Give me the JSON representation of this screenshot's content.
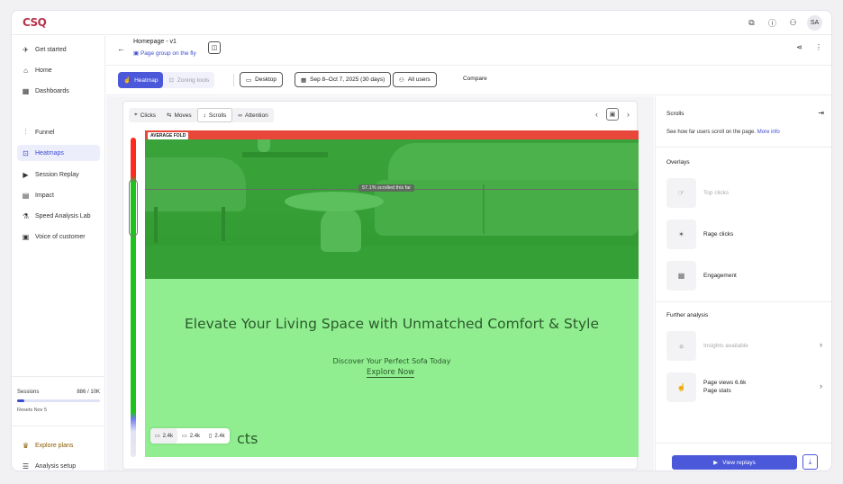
{
  "app": {
    "logo": "CSQ",
    "avatar": "SA"
  },
  "sidebar": {
    "items": [
      {
        "label": "Get started",
        "icon": "rocket-icon"
      },
      {
        "label": "Home",
        "icon": "home-icon"
      },
      {
        "label": "Dashboards",
        "icon": "grid-icon"
      },
      {
        "label": "Funnel",
        "icon": "funnel-icon"
      },
      {
        "label": "Heatmaps",
        "icon": "heatmap-icon"
      },
      {
        "label": "Session Replay",
        "icon": "play-icon"
      },
      {
        "label": "Impact",
        "icon": "impact-icon"
      },
      {
        "label": "Speed Analysis Lab",
        "icon": "speed-icon"
      },
      {
        "label": "Voice of customer",
        "icon": "voc-icon"
      }
    ],
    "sessions": {
      "label": "Sessions",
      "count": "886 / 10K",
      "progress": 0.0886,
      "reset": "Resets Nov 5"
    },
    "explore_plans": "Explore plans",
    "analysis_setup": "Analysis setup"
  },
  "header": {
    "title": "Homepage - v1",
    "subtitle": "Page group on the fly"
  },
  "filters": {
    "mode_heatmap": "Heatmap",
    "mode_zoning": "Zoning tools",
    "device": "Desktop",
    "date": "Sep 8–Oct 7, 2025 (30 days)",
    "users": "All users",
    "compare": "Compare"
  },
  "toolbar": {
    "clicks": "Clicks",
    "moves": "Moves",
    "scrolls": "Scrolls",
    "attention": "Attention"
  },
  "heatmap": {
    "fold_label": "AVERAGE FOLD",
    "scroll_tip": "57.1% scrolled this far",
    "hero_title": "Elevate Your Living Space with Unmatched Comfort & Style",
    "hero_sub": "Discover Your Perfect Sofa Today",
    "hero_link": "Explore Now",
    "cut_heading": "cts",
    "devices": [
      {
        "icon": "desktop-icon",
        "count": "2.4k"
      },
      {
        "icon": "tablet-icon",
        "count": "2.4k"
      },
      {
        "icon": "mobile-icon",
        "count": "2.4k"
      }
    ]
  },
  "rpanel": {
    "title": "Scrolls",
    "desc": "See how far users scroll on the page.",
    "more": "More info",
    "overlays_title": "Overlays",
    "overlays": [
      {
        "label": "Top clicks",
        "dim": true
      },
      {
        "label": "Rage clicks",
        "dim": false
      },
      {
        "label": "Engagement",
        "dim": false
      }
    ],
    "further_title": "Further analysis",
    "insights": "Insights available",
    "pageviews": "Page views 6.6k",
    "pagestats": "Page stats",
    "view_replays": "View replays"
  },
  "colors": {
    "accent": "#4a58d9",
    "brand": "#b8324a",
    "scroll_hot": "#ff2a1e",
    "scroll_mid": "#1ec41e",
    "overlay": "#90ee90"
  }
}
